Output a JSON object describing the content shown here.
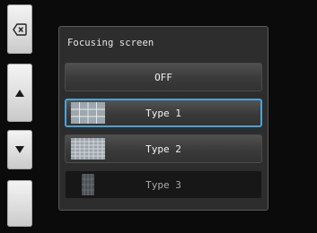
{
  "side_buttons": [
    {
      "id": "back",
      "icon": "backspace-x-icon"
    },
    {
      "id": "up",
      "icon": "triangle-up-icon"
    },
    {
      "id": "down",
      "icon": "triangle-down-icon"
    },
    {
      "id": "blank",
      "icon": ""
    }
  ],
  "panel": {
    "title": "Focusing screen",
    "options": [
      {
        "label": "OFF",
        "selected": false,
        "thumbnail": null
      },
      {
        "label": "Type 1",
        "selected": true,
        "thumbnail": "grid-icon"
      },
      {
        "label": "Type 2",
        "selected": false,
        "thumbnail": "dense-grid-icon"
      },
      {
        "label": "Type 3",
        "selected": false,
        "thumbnail": "vertical-lines-icon"
      }
    ]
  },
  "colors": {
    "selection_border": "#4aa3d8",
    "panel_bg": "#2d2d2d"
  }
}
